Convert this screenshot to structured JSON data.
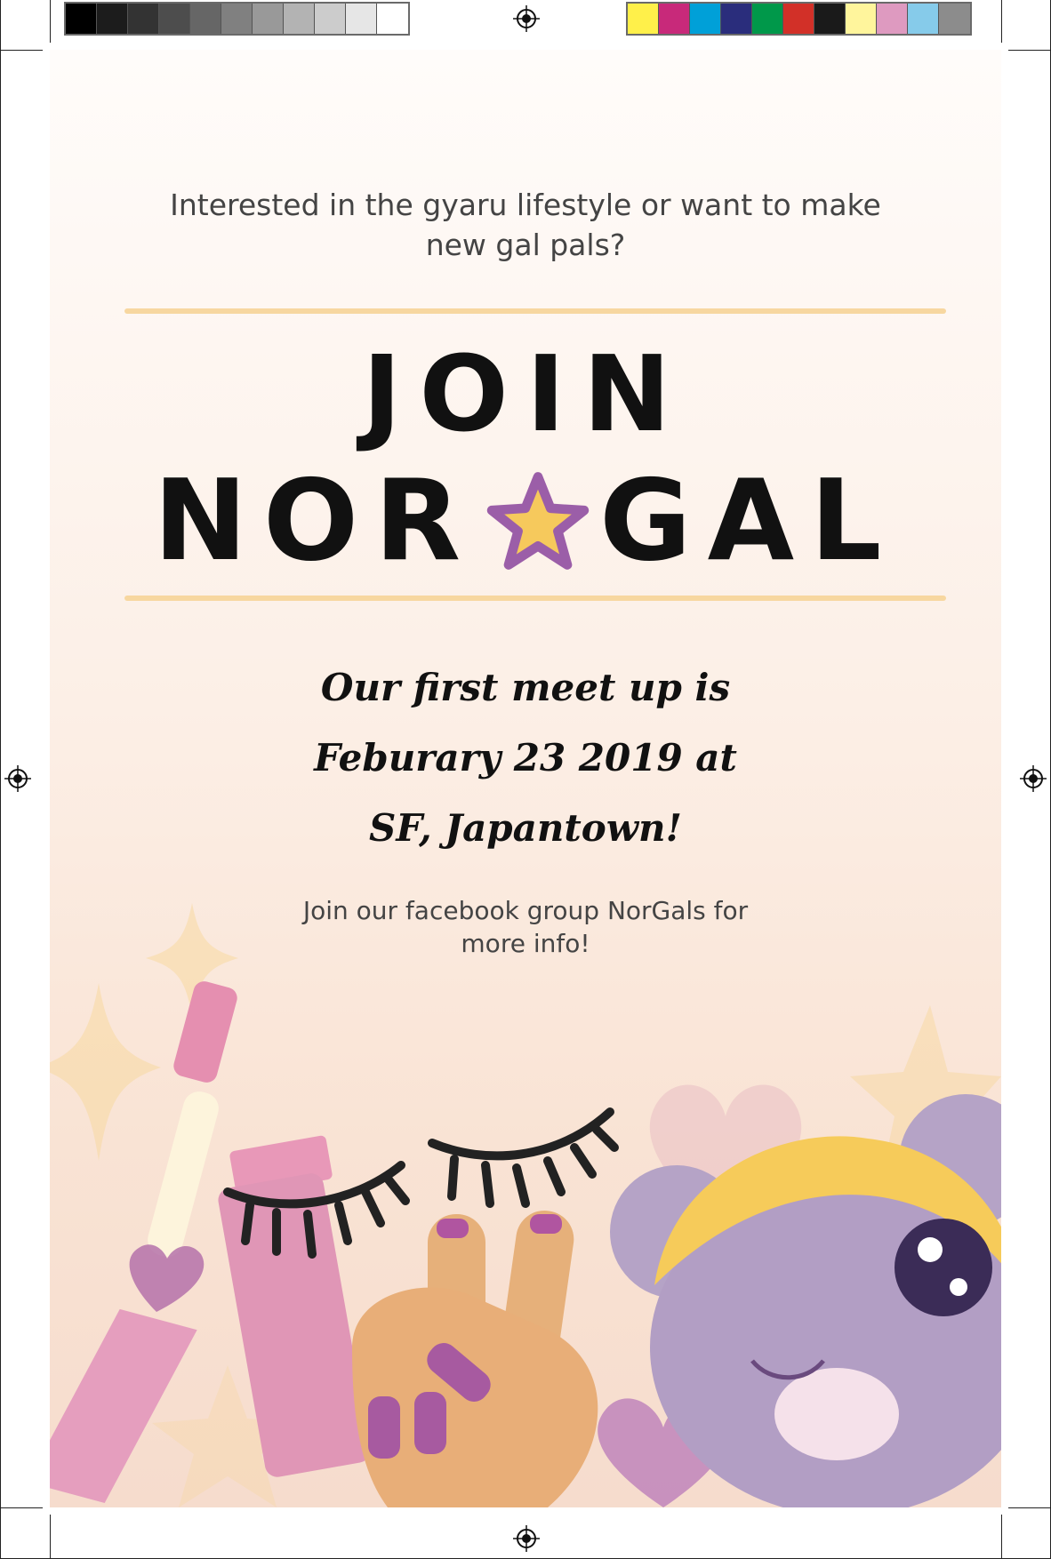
{
  "poster": {
    "intro": "Interested in the gyaru lifestyle or want to make new gal pals?",
    "title_line1": "JOIN",
    "title_line2_left": "NOR",
    "title_line2_right": "GAL",
    "details_line1": "Our first meet up is",
    "details_line2": "Feburary 23 2019 at",
    "details_line3": "SF, Japantown!",
    "footer": "Join our facebook group NorGals for more info!",
    "rule_color": "#f7d7a0",
    "star_outline_color": "#9b5ea8",
    "star_fill_color": "#f6c95c"
  },
  "print_marks": {
    "grayscale_swatches": [
      "#000000",
      "#1c1c1c",
      "#333333",
      "#4d4d4d",
      "#666666",
      "#808080",
      "#999999",
      "#b3b3b3",
      "#cccccc",
      "#e6e6e6",
      "#ffffff"
    ],
    "color_swatches": [
      "#fff04a",
      "#c8297a",
      "#00a0d8",
      "#2a2d7c",
      "#00984a",
      "#d23028",
      "#1a1a1a",
      "#fff59c",
      "#de9ac0",
      "#86cbea",
      "#8c8c8c"
    ]
  }
}
